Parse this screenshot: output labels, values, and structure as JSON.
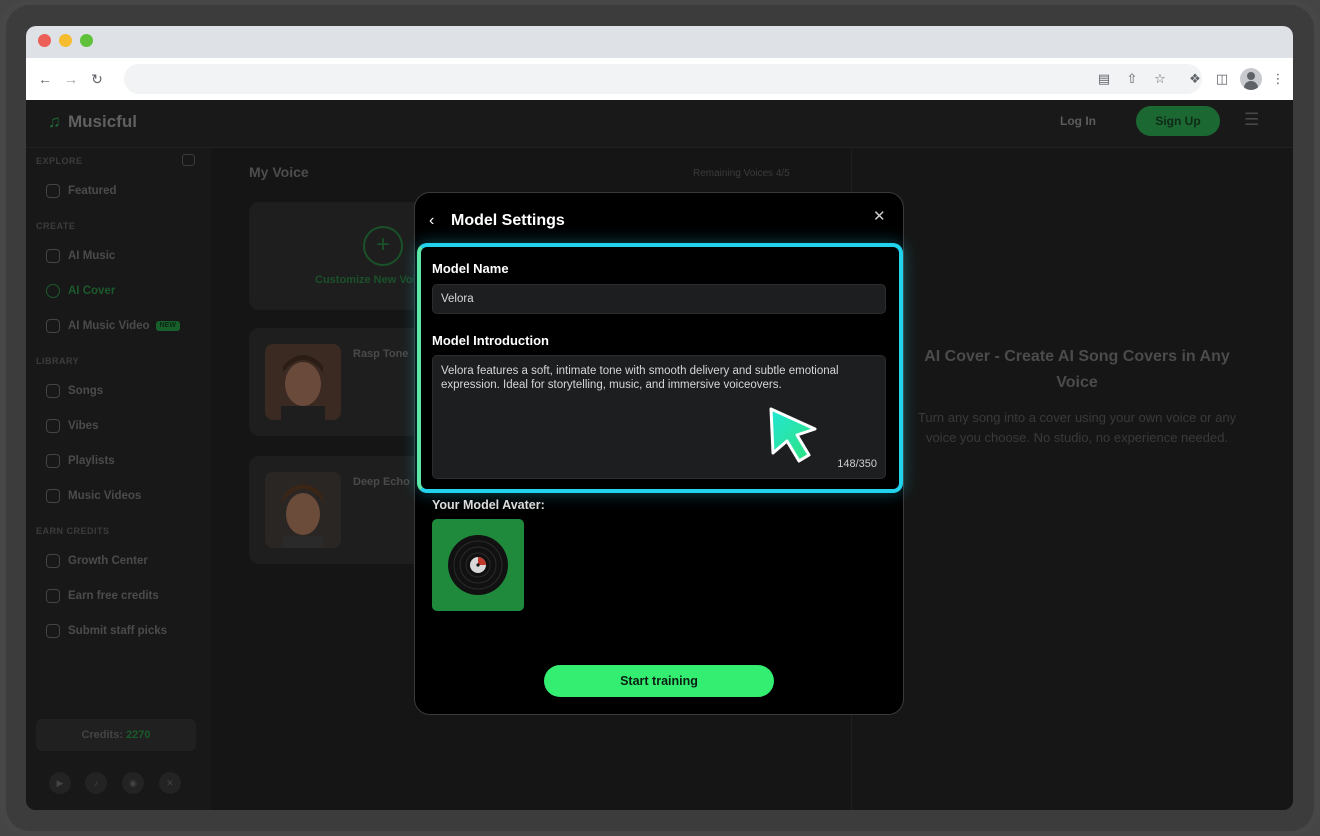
{
  "browser": {
    "traffic_colors": [
      "#ec5f57",
      "#f5bd2e",
      "#60c13b"
    ],
    "icons": [
      "back-arrow-icon",
      "forward-arrow-icon",
      "reload-icon",
      "clipboard-icon",
      "share-icon",
      "star-icon",
      "puzzle-icon",
      "side-panel-icon",
      "profile-icon",
      "kebab-menu-icon"
    ]
  },
  "app": {
    "brand": "Musicful",
    "login_label": "Log In",
    "signup_label": "Sign Up",
    "accent": "#1f6a37"
  },
  "sidebar": {
    "sections": {
      "explore": "EXPLORE",
      "create": "CREATE",
      "library": "LIBRARY",
      "earn": "EARN CREDITS"
    },
    "items": [
      {
        "label": "Featured"
      },
      {
        "label": "AI Music"
      },
      {
        "label": "AI Cover"
      },
      {
        "label": "AI Music Video"
      },
      {
        "label": "Songs"
      },
      {
        "label": "Vibes"
      },
      {
        "label": "Playlists"
      },
      {
        "label": "Music Videos"
      },
      {
        "label": "Growth Center"
      },
      {
        "label": "Earn free credits"
      },
      {
        "label": "Submit staff picks"
      }
    ],
    "new_badge": "NEW",
    "credits_label": "Credits:",
    "credits_value": "2270"
  },
  "main": {
    "title": "My Voice",
    "remaining": "Remaining Voices 4/5",
    "create_label": "Customize New Voice",
    "voices": [
      {
        "name": "Rasp Tone"
      },
      {
        "name": "Deep Echo"
      }
    ]
  },
  "right_panel": {
    "title": "AI Cover - Create AI Song Covers in Any Voice",
    "subtitle": "Turn any song into a cover using your own voice or any voice you choose. No studio, no experience needed."
  },
  "modal": {
    "title": "Model Settings",
    "model_name_label": "Model Name",
    "model_name_value": "Velora",
    "intro_label": "Model Introduction",
    "intro_value": "Velora features a soft, intimate tone with smooth delivery and subtle emotional expression. Ideal for storytelling, music, and immersive voiceovers.",
    "char_count": "148/350",
    "avatar_label": "Your Model Avater:",
    "start_label": "Start training",
    "highlight_color": "#22d3ee",
    "button_color": "#34ee72"
  }
}
